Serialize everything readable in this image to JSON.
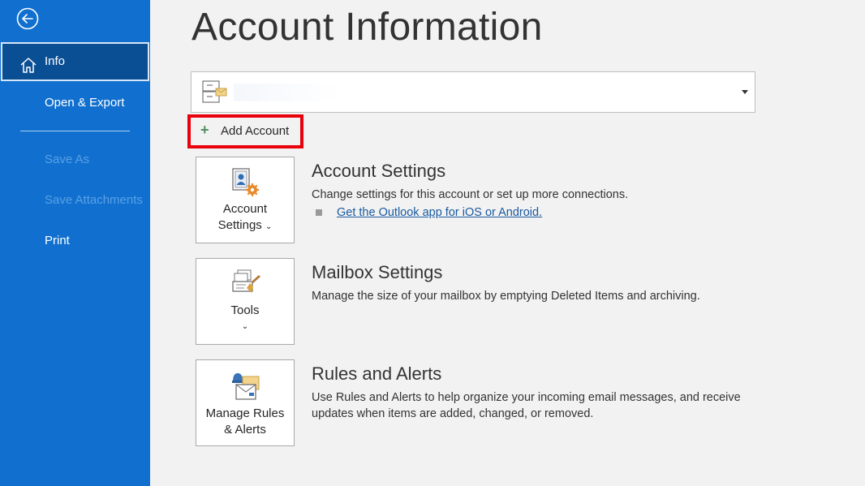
{
  "sidebar": {
    "items": [
      {
        "label": "Info",
        "active": true
      },
      {
        "label": "Open & Export"
      },
      {
        "label": "Save As",
        "disabled": true
      },
      {
        "label": "Save Attachments",
        "disabled": true
      },
      {
        "label": "Print"
      }
    ]
  },
  "main": {
    "title": "Account Information",
    "add_account_label": "Add Account",
    "sections": [
      {
        "tile_label_line1": "Account",
        "tile_label_line2": "Settings",
        "title": "Account Settings",
        "description": "Change settings for this account or set up more connections.",
        "link": "Get the Outlook app for iOS or Android."
      },
      {
        "tile_label_line1": "Tools",
        "title": "Mailbox Settings",
        "description": "Manage the size of your mailbox by emptying Deleted Items and archiving."
      },
      {
        "tile_label_line1": "Manage Rules",
        "tile_label_line2": "& Alerts",
        "title": "Rules and Alerts",
        "description_line1": "Use Rules and Alerts to help organize your incoming email messages, and receive",
        "description_line2": "updates when items are added, changed, or removed."
      }
    ]
  },
  "colors": {
    "sidebar": "#1170cf",
    "sidebar_active": "#0a4f94",
    "highlight_box": "#e8000b",
    "link": "#1a5aa0"
  },
  "icons": [
    "back-arrow-icon",
    "home-icon",
    "account-card-icon",
    "dropdown-caret-icon",
    "plus-icon",
    "account-settings-icon",
    "tools-icon",
    "rules-alerts-icon",
    "chevron-down-icon"
  ]
}
